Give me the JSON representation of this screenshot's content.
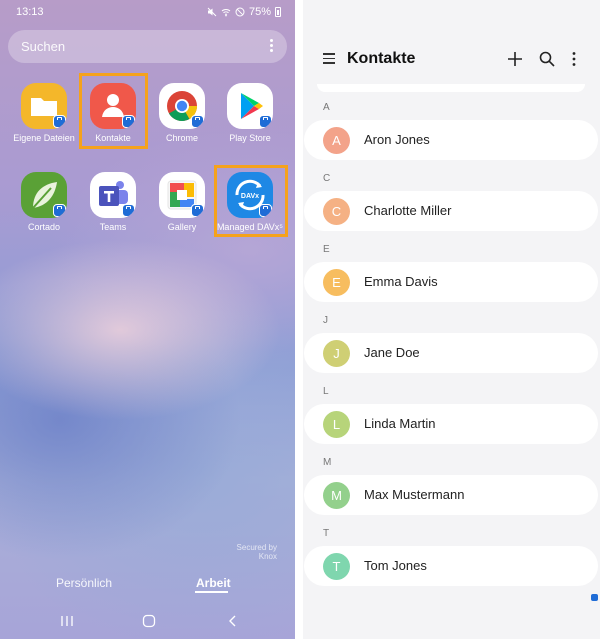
{
  "launcher": {
    "status": {
      "time": "13:13",
      "battery_text": "75%"
    },
    "search": {
      "placeholder": "Suchen"
    },
    "apps": [
      {
        "label": "Eigene Dateien",
        "icon": "folder-icon",
        "highlighted": false
      },
      {
        "label": "Kontakte",
        "icon": "contacts-icon",
        "highlighted": true
      },
      {
        "label": "Chrome",
        "icon": "chrome-icon",
        "highlighted": false
      },
      {
        "label": "Play Store",
        "icon": "play-store-icon",
        "highlighted": false
      },
      {
        "label": "Cortado",
        "icon": "cortado-leaf-icon",
        "highlighted": false
      },
      {
        "label": "Teams",
        "icon": "teams-icon",
        "highlighted": false
      },
      {
        "label": "Gallery",
        "icon": "gallery-icon",
        "highlighted": false
      },
      {
        "label": "Managed DAVx⁵",
        "icon": "davx-sync-icon",
        "highlighted": true
      }
    ],
    "knox_text": [
      "Secured by",
      "Knox"
    ],
    "profile_tabs": [
      {
        "label": "Persönlich",
        "active": false
      },
      {
        "label": "Arbeit",
        "active": true
      }
    ],
    "highlight_color": "#f5a21c",
    "work_badge_color": "#1f6cd6"
  },
  "contacts": {
    "title": "Kontakte",
    "sections": [
      {
        "letter": "A",
        "name": "Aron Jones",
        "initial": "A",
        "color": "#f3a38a"
      },
      {
        "letter": "C",
        "name": "Charlotte Miller",
        "initial": "C",
        "color": "#f5b184"
      },
      {
        "letter": "E",
        "name": "Emma Davis",
        "initial": "E",
        "color": "#f7bd5f"
      },
      {
        "letter": "J",
        "name": "Jane Doe",
        "initial": "J",
        "color": "#cfcf74"
      },
      {
        "letter": "L",
        "name": "Linda Martin",
        "initial": "L",
        "color": "#b7d47a"
      },
      {
        "letter": "M",
        "name": "Max Mustermann",
        "initial": "M",
        "color": "#93d08c"
      },
      {
        "letter": "T",
        "name": "Tom Jones",
        "initial": "T",
        "color": "#7fd6ae"
      }
    ]
  }
}
